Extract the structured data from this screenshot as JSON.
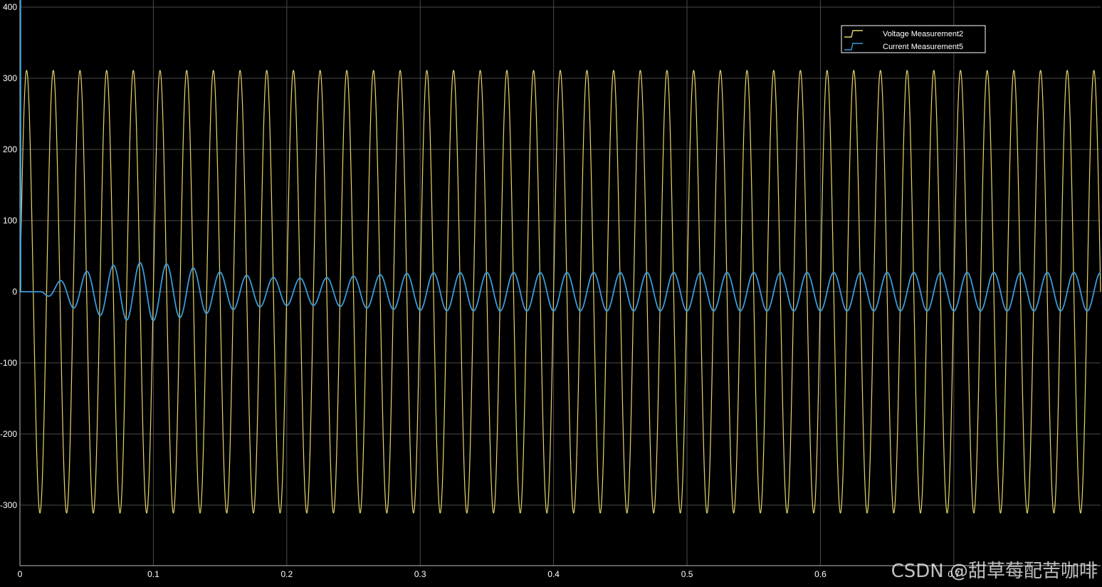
{
  "chart_data": {
    "type": "line",
    "xlim": [
      0,
      0.81
    ],
    "ylim": [
      -385,
      410
    ],
    "x_ticks": [
      0,
      0.1,
      0.2,
      0.3,
      0.4,
      0.5,
      0.6,
      0.7
    ],
    "x_tick_labels": [
      "0",
      "0.1",
      "0.2",
      "0.3",
      "0.4",
      "0.5",
      "0.6",
      "0.7"
    ],
    "y_ticks": [
      -300,
      -200,
      -100,
      0,
      100,
      200,
      300,
      400
    ],
    "y_tick_labels": [
      "-300",
      "-200",
      "-100",
      "0",
      "100",
      "200",
      "300",
      "400"
    ],
    "grid": true,
    "legend_position": "top-right",
    "series": [
      {
        "name": "Voltage Measurement2",
        "color": "#e8d56a",
        "model": "sine",
        "amplitude": 311,
        "frequency_hz": 50,
        "phase_deg": 0
      },
      {
        "name": "Current Measurement5",
        "color": "#3a9bdc",
        "model": "damped-sine",
        "start_time": 0.016,
        "steady_amplitude": 27,
        "peak_amplitude": 42,
        "peak_time": 0.09,
        "frequency_hz": 50,
        "phase_deg": -90,
        "initial_spike": 410
      }
    ]
  },
  "watermark": "CSDN @甜草莓配苦咖啡",
  "colors": {
    "background": "#000000",
    "grid": "#4a4a4a",
    "axis_text": "#ffffff",
    "legend_border": "#ffffff"
  }
}
